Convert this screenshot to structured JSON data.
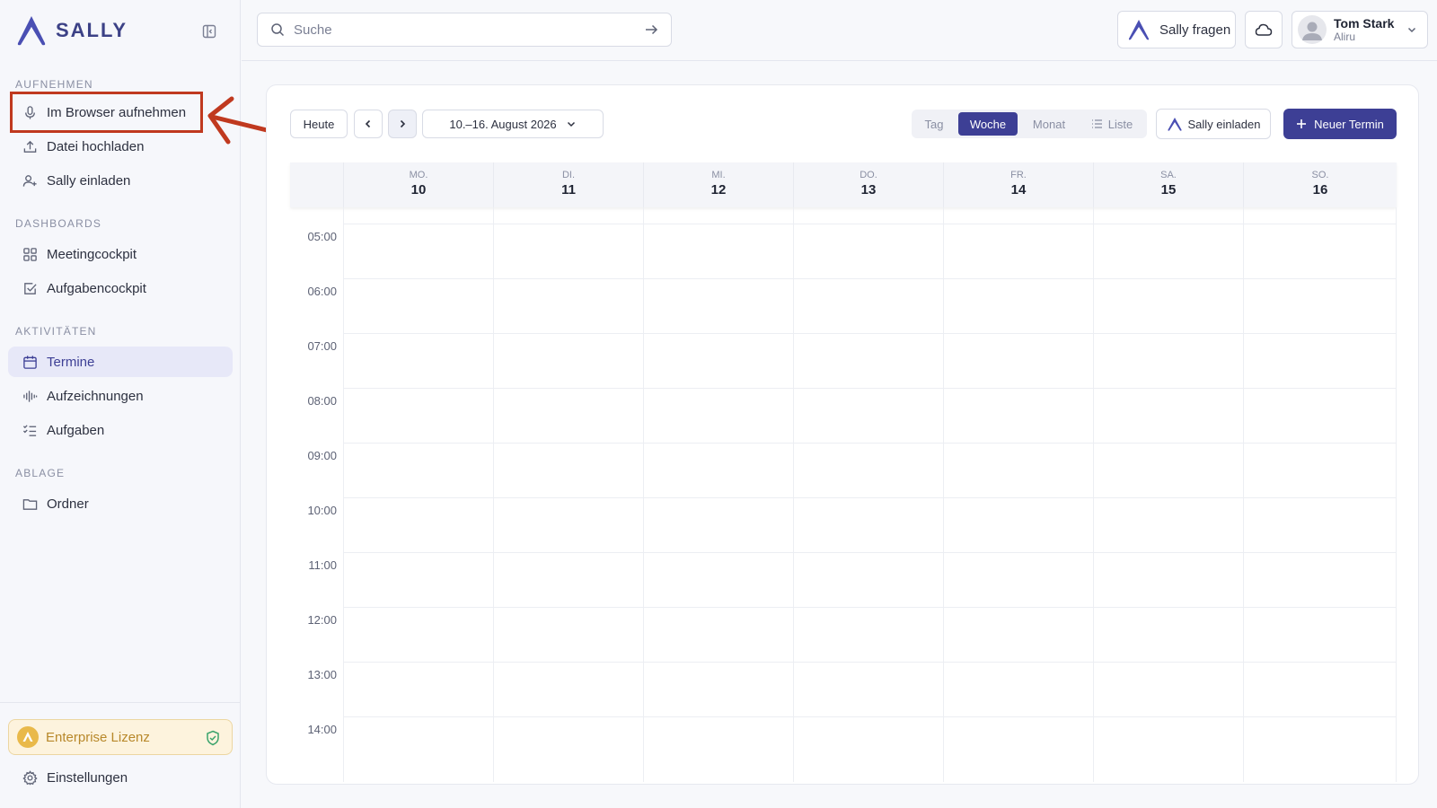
{
  "brand": {
    "name": "SALLY"
  },
  "sidebar": {
    "sections": {
      "record": "AUFNEHMEN",
      "dashboards": "DASHBOARDS",
      "activities": "AKTIVITÄTEN",
      "storage": "ABLAGE"
    },
    "items": {
      "record_browser": "Im Browser aufnehmen",
      "upload_file": "Datei hochladen",
      "invite_sally": "Sally einladen",
      "meetingcockpit": "Meetingcockpit",
      "taskcockpit": "Aufgabencockpit",
      "appointments": "Termine",
      "recordings": "Aufzeichnungen",
      "tasks": "Aufgaben",
      "folders": "Ordner"
    },
    "license": "Enterprise Lizenz",
    "settings": "Einstellungen"
  },
  "search": {
    "placeholder": "Suche"
  },
  "header": {
    "ask": "Sally fragen",
    "user": {
      "name": "Tom Stark",
      "org": "Aliru"
    }
  },
  "calendar": {
    "today": "Heute",
    "range": "10.–16. August 2026",
    "views": {
      "day": "Tag",
      "week": "Woche",
      "month": "Monat",
      "list": "Liste"
    },
    "invite": "Sally einladen",
    "new_event": "Neuer Termin",
    "days": [
      {
        "abbr": "MO.",
        "num": "10"
      },
      {
        "abbr": "DI.",
        "num": "11"
      },
      {
        "abbr": "MI.",
        "num": "12"
      },
      {
        "abbr": "DO.",
        "num": "13"
      },
      {
        "abbr": "FR.",
        "num": "14"
      },
      {
        "abbr": "SA.",
        "num": "15"
      },
      {
        "abbr": "SO.",
        "num": "16"
      }
    ],
    "hours": [
      "05:00",
      "06:00",
      "07:00",
      "08:00",
      "09:00",
      "10:00",
      "11:00",
      "12:00",
      "13:00",
      "14:00"
    ]
  },
  "colors": {
    "accent": "#3d3f95",
    "highlight": "#c0391f",
    "license": "#b8882a"
  }
}
